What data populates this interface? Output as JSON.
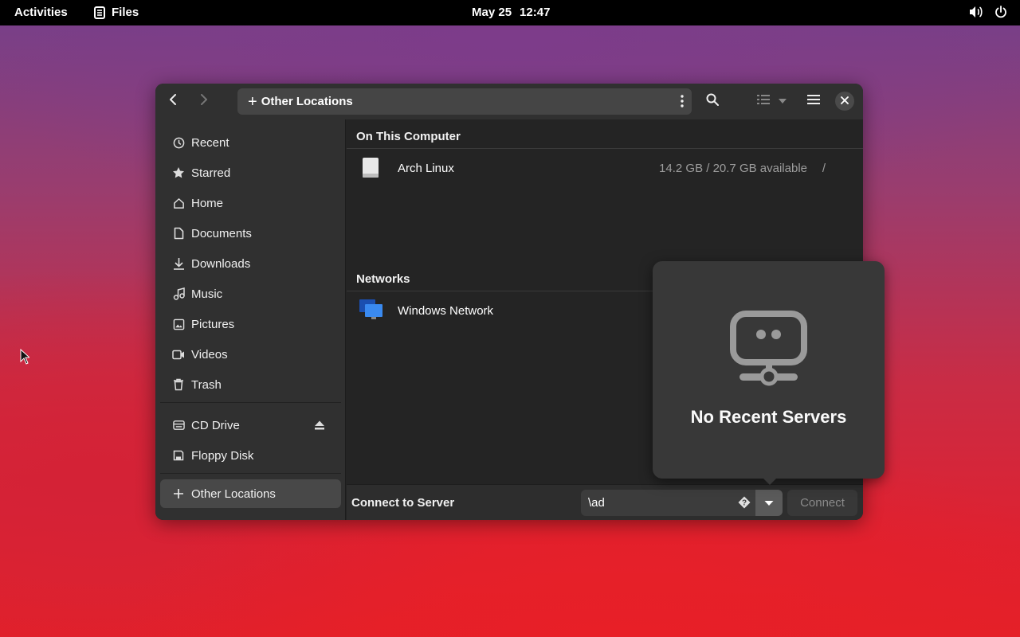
{
  "topbar": {
    "activities": "Activities",
    "app_name": "Files",
    "app_icon": "files-icon",
    "date": "May 25",
    "time": "12:47",
    "status_icons": [
      "volume-icon",
      "power-icon"
    ]
  },
  "headerbar": {
    "back_icon": "chevron-left-icon",
    "forward_icon": "chevron-right-icon",
    "path_label": "Other Locations",
    "path_icon": "plus-icon",
    "path_menu_icon": "vertical-dots-icon",
    "search_icon": "search-icon",
    "view_icon": "list-view-icon",
    "view_dropdown_icon": "chevron-down-icon",
    "menu_icon": "hamburger-menu-icon",
    "close_icon": "close-icon"
  },
  "sidebar": {
    "items": [
      {
        "label": "Recent",
        "icon": "clock-icon"
      },
      {
        "label": "Starred",
        "icon": "star-icon"
      },
      {
        "label": "Home",
        "icon": "home-icon"
      },
      {
        "label": "Documents",
        "icon": "document-icon"
      },
      {
        "label": "Downloads",
        "icon": "download-icon"
      },
      {
        "label": "Music",
        "icon": "music-icon"
      },
      {
        "label": "Pictures",
        "icon": "picture-icon"
      },
      {
        "label": "Videos",
        "icon": "video-icon"
      },
      {
        "label": "Trash",
        "icon": "trash-icon"
      }
    ],
    "devices": [
      {
        "label": "CD Drive",
        "icon": "optical-drive-icon",
        "eject_icon": "eject-icon"
      },
      {
        "label": "Floppy Disk",
        "icon": "floppy-icon"
      }
    ],
    "other_locations": {
      "label": "Other Locations",
      "icon": "plus-icon",
      "active": true
    }
  },
  "main": {
    "on_this_computer": {
      "title": "On This Computer",
      "items": [
        {
          "name": "Arch Linux",
          "availability": "14.2 GB / 20.7 GB available",
          "mount": "/",
          "icon": "drive-icon"
        }
      ]
    },
    "networks": {
      "title": "Networks",
      "items": [
        {
          "name": "Windows Network",
          "icon": "network-computer-icon"
        }
      ]
    }
  },
  "bottombar": {
    "label": "Connect to Server",
    "input_value": "\\ad",
    "input_hint_icon": "help-diamond-icon",
    "dropdown_icon": "chevron-down-icon",
    "connect_label": "Connect"
  },
  "popover": {
    "icon": "network-server-icon",
    "title": "No Recent Servers"
  },
  "colors": {
    "window_bg": "#242424",
    "sidebar_bg": "#303030",
    "headerbar_bg": "#303030",
    "popover_bg": "#383838",
    "secondary_text": "#9d9d9d"
  }
}
